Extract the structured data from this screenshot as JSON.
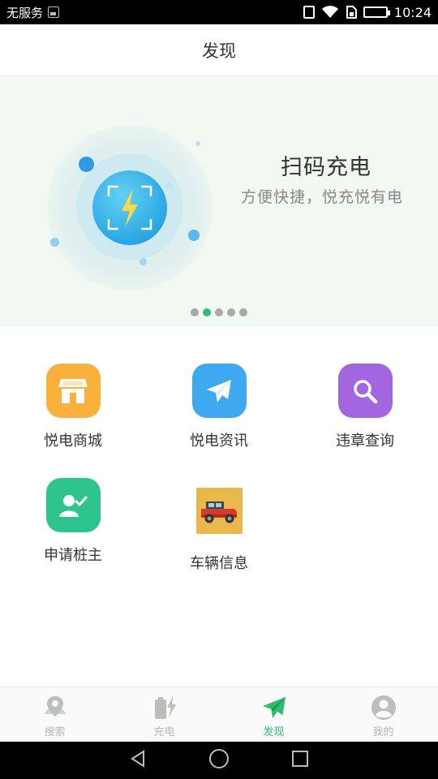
{
  "status_bar": {
    "carrier": "无服务",
    "time": "10:24"
  },
  "header": {
    "title": "发现"
  },
  "banner": {
    "title": "扫码充电",
    "subtitle": "方便快捷，悦充悦有电",
    "page_count": 5,
    "active_page": 2
  },
  "grid": {
    "items": [
      {
        "label": "悦电商城",
        "icon": "store-icon",
        "color": "#fbb03b"
      },
      {
        "label": "悦电资讯",
        "icon": "paper-plane-icon",
        "color": "#3ea8f0"
      },
      {
        "label": "违章查询",
        "icon": "search-icon",
        "color": "#a366e0"
      },
      {
        "label": "申请桩主",
        "icon": "user-check-icon",
        "color": "#2ec48e"
      },
      {
        "label": "车辆信息",
        "icon": "jeep-icon",
        "color": "#e8b84a"
      }
    ]
  },
  "bottom_nav": {
    "tabs": [
      {
        "label": "搜索",
        "icon": "map-pin-icon",
        "active": false
      },
      {
        "label": "充电",
        "icon": "battery-charge-icon",
        "active": false
      },
      {
        "label": "发现",
        "icon": "paper-plane-icon",
        "active": true
      },
      {
        "label": "我的",
        "icon": "user-icon",
        "active": false
      }
    ]
  },
  "colors": {
    "accent": "#2fbd6f",
    "inactive": "#b5b9b5",
    "banner_bg": "#f2f8f2"
  }
}
